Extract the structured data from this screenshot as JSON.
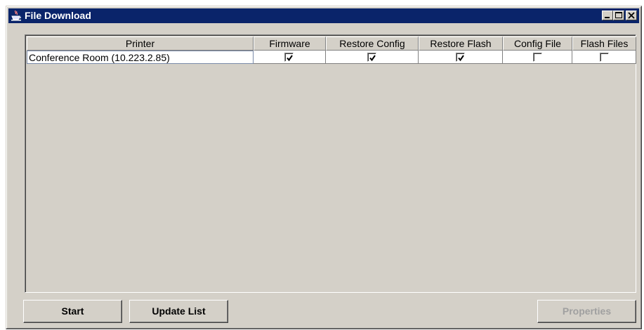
{
  "window": {
    "title": "File Download",
    "title_bar_color": "#0a246a"
  },
  "title_buttons": [
    "minimize-icon",
    "maximize-icon",
    "close-icon"
  ],
  "table": {
    "columns": [
      "Printer",
      "Firmware",
      "Restore Config",
      "Restore Flash",
      "Config File",
      "Flash Files"
    ],
    "rows": [
      {
        "printer": "Conference Room (10.223.2.85)",
        "firmware": true,
        "restore_config": true,
        "restore_flash": true,
        "config_file": false,
        "flash_files": false
      }
    ]
  },
  "buttons": {
    "start": "Start",
    "update_list": "Update List",
    "properties": "Properties"
  }
}
